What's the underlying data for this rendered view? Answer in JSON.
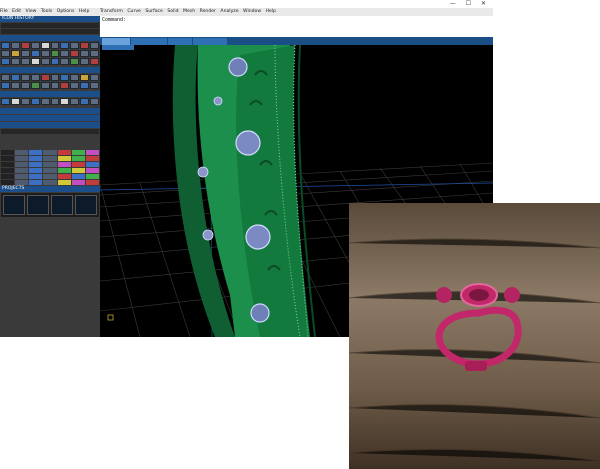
{
  "window": {
    "title": "",
    "controls": "— ☐ ✕"
  },
  "menu": {
    "items": [
      "File",
      "Edit",
      "View",
      "Tools",
      "Options",
      "Help"
    ]
  },
  "menu_right": {
    "items": [
      "Transform",
      "Curve",
      "Surface",
      "Solid",
      "Mesh",
      "Render",
      "Analyze",
      "Window",
      "Help"
    ]
  },
  "command": {
    "line1": "",
    "line2": "",
    "prompt": "Command:"
  },
  "viewport_tabs": [
    "",
    "",
    "",
    ""
  ],
  "sub_tab": "",
  "left_sections": [
    "ICON HISTORY",
    "",
    "",
    "",
    "",
    "",
    "PROJECTS"
  ],
  "colors": {
    "accent": "#1a4f86",
    "ring_green": "#1d8f4d",
    "photo_resin": "#c2276a"
  },
  "icons": [
    "ring-model-render",
    "wax-ring-photo"
  ]
}
